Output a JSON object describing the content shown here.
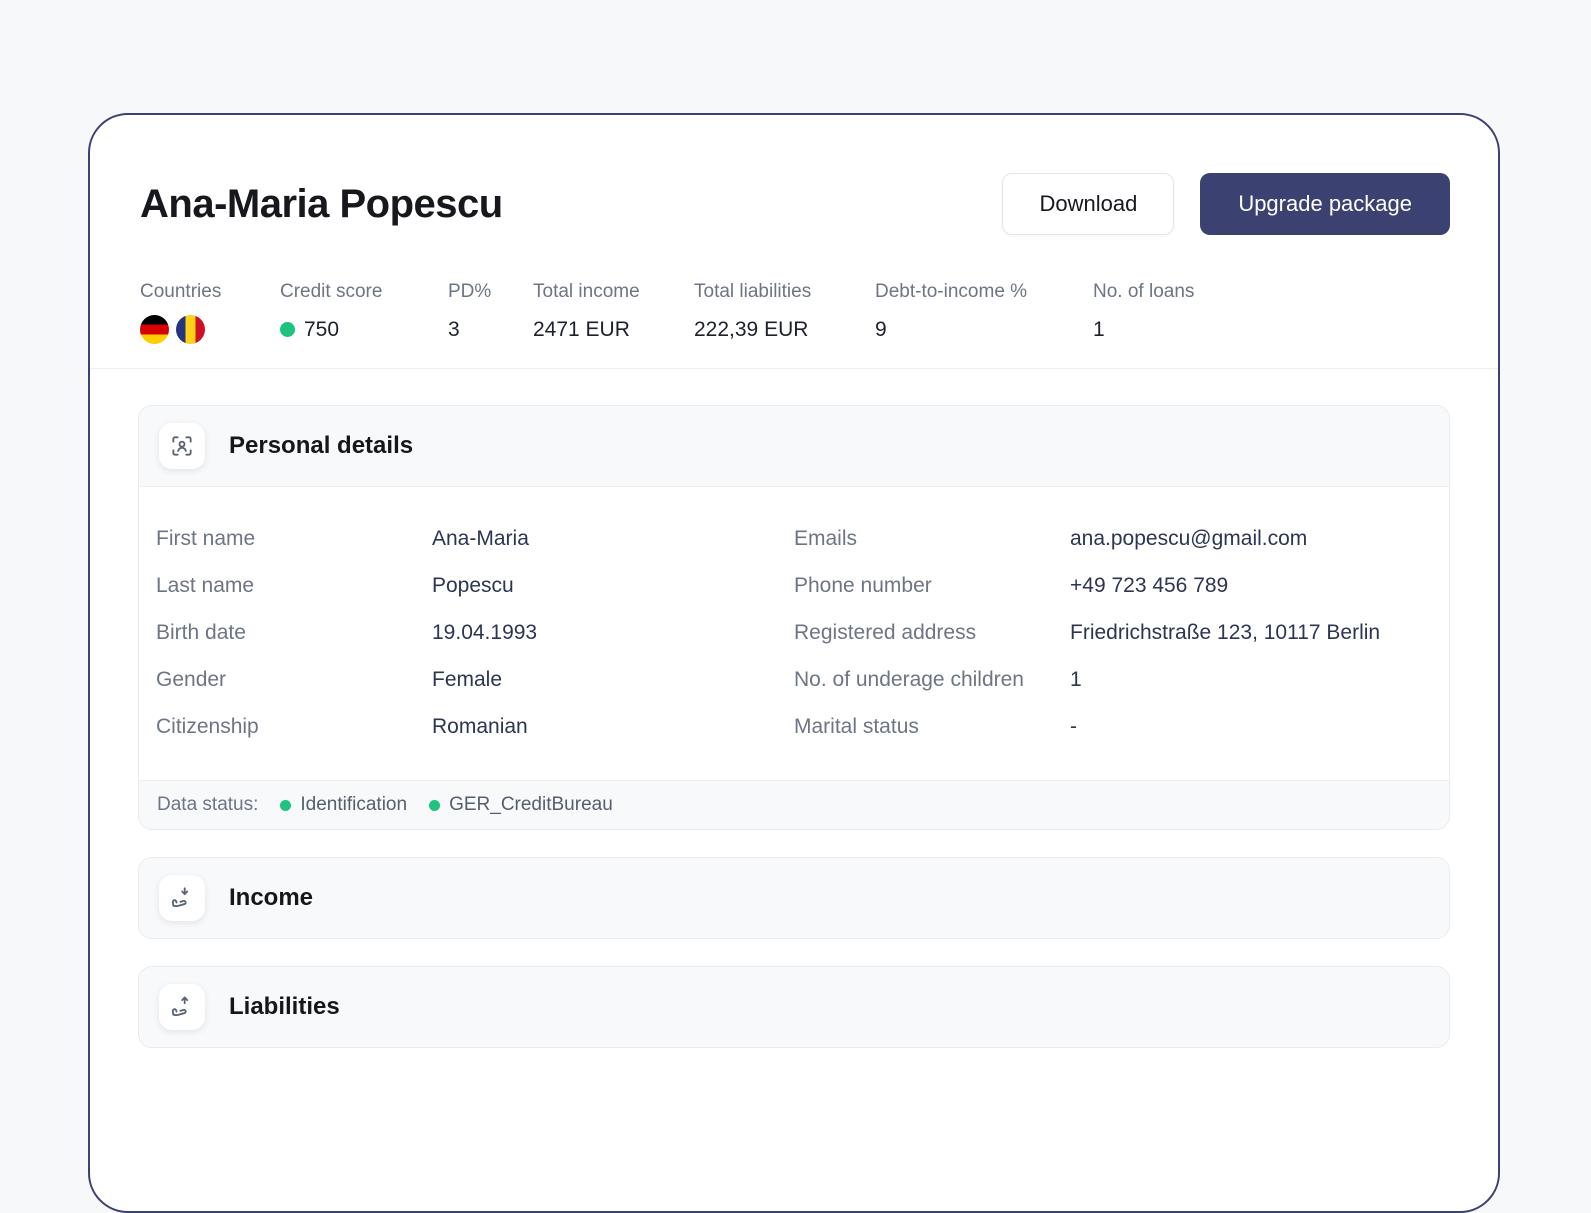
{
  "colors": {
    "accent": "#3b4170",
    "positive": "#1ec37d"
  },
  "header": {
    "name": "Ana-Maria Popescu",
    "download_label": "Download",
    "upgrade_label": "Upgrade package"
  },
  "stats": {
    "countries_label": "Countries",
    "flags": [
      "germany",
      "romania"
    ],
    "items": [
      {
        "label": "Credit score",
        "value": "750"
      },
      {
        "label": "PD%",
        "value": "3"
      },
      {
        "label": "Total income",
        "value": "2471 EUR"
      },
      {
        "label": "Total liabilities",
        "value": "222,39 EUR"
      },
      {
        "label": "Debt-to-income %",
        "value": "9"
      },
      {
        "label": "No. of loans",
        "value": "1"
      }
    ]
  },
  "personal_details": {
    "title": "Personal details",
    "left": [
      {
        "label": "First name",
        "value": "Ana-Maria"
      },
      {
        "label": "Last name",
        "value": "Popescu"
      },
      {
        "label": "Birth date",
        "value": "19.04.1993"
      },
      {
        "label": "Gender",
        "value": "Female"
      },
      {
        "label": "Citizenship",
        "value": "Romanian"
      }
    ],
    "right": [
      {
        "label": "Emails",
        "value": "ana.popescu@gmail.com"
      },
      {
        "label": "Phone number",
        "value": "+49 723 456 789"
      },
      {
        "label": "Registered address",
        "value": "Friedrichstraße 123, 10117 Berlin"
      },
      {
        "label": "No. of underage children",
        "value": "1"
      },
      {
        "label": "Marital status",
        "value": "-"
      }
    ],
    "data_status": {
      "label": "Data status:",
      "items": [
        "Identification",
        "GER_CreditBureau"
      ]
    }
  },
  "sections": [
    {
      "title": "Income"
    },
    {
      "title": "Liabilities"
    }
  ]
}
